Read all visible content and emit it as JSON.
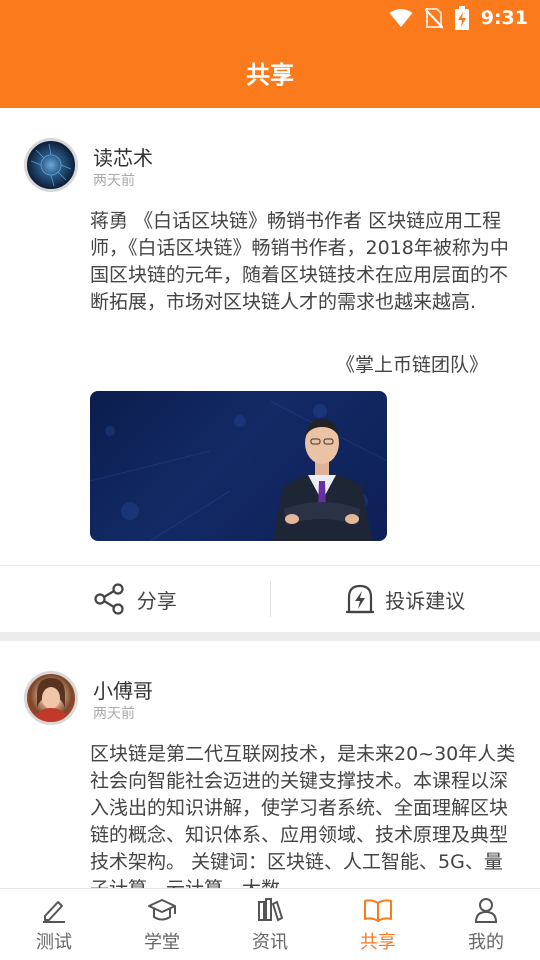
{
  "status_bar": {
    "time": "9:31",
    "icons": [
      "wifi-icon",
      "no-sim-icon",
      "battery-charging-icon"
    ]
  },
  "header": {
    "title": "共享"
  },
  "posts": [
    {
      "author": "读芯术",
      "time": "两天前",
      "body": "蒋勇 《白话区块链》畅销书作者 区块链应用工程师，《白话区块链》畅销书作者，2018年被称为中国区块链的元年，随着区块链技术在应用层面的不断拓展，市场对区块链人才的需求也越来越高.",
      "signature": "《掌上币链团队》",
      "actions": {
        "share": "分享",
        "report": "投诉建议"
      }
    },
    {
      "author": "小傅哥",
      "time": "两天前",
      "body": "区块链是第二代互联网技术，是未来20~30年人类社会向智能社会迈进的关键支撑技术。本课程以深入浅出的知识讲解，使学习者系统、全面理解区块链的概念、知识体系、应用领域、技术原理及典型技术架构。 关键词：区块链、人工智能、5G、量子计算、云计算、大数"
    }
  ],
  "bottom_nav": {
    "items": [
      {
        "label": "测试",
        "icon": "pencil-icon"
      },
      {
        "label": "学堂",
        "icon": "graduation-cap-icon"
      },
      {
        "label": "资讯",
        "icon": "books-icon"
      },
      {
        "label": "共享",
        "icon": "open-book-icon",
        "active": true
      },
      {
        "label": "我的",
        "icon": "user-icon"
      }
    ]
  },
  "colors": {
    "accent": "#fb7a1c",
    "text": "#444444",
    "muted": "#aaaaaa"
  }
}
